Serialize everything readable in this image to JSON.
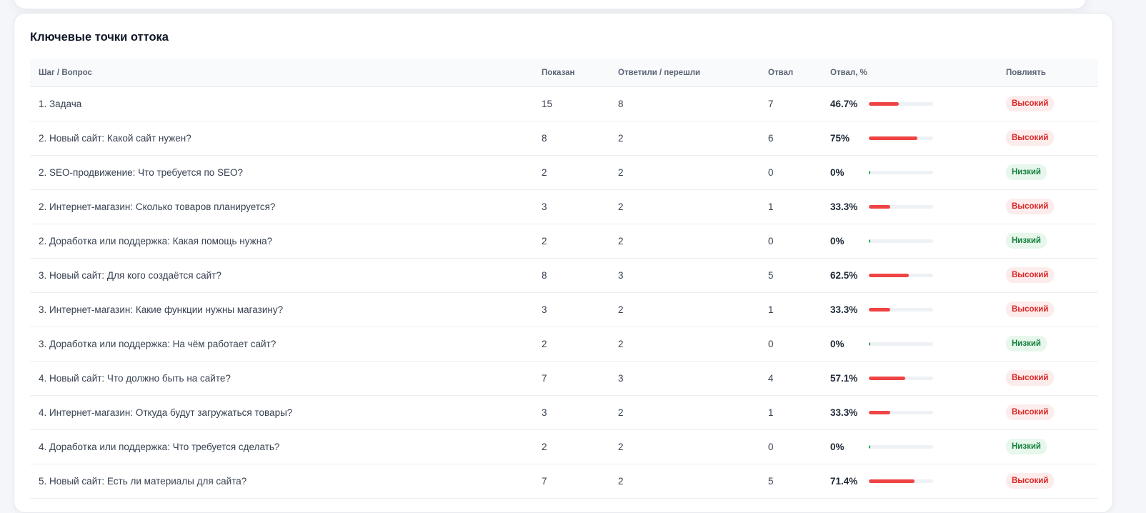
{
  "title": "Ключевые точки оттока",
  "columns": [
    "Шаг / Вопрос",
    "Показан",
    "Ответили / перешли",
    "Отвал",
    "Отвал, %",
    "Повлиять"
  ],
  "colors": {
    "high_badge_bg": "#fdecec",
    "high_badge_text": "#dc2626",
    "low_badge_bg": "#e7f7ec",
    "low_badge_text": "#15803d",
    "bar_fill": "#ef4444"
  },
  "rows": [
    {
      "step": "1. Задача",
      "shown": "15",
      "answered": "8",
      "dropped": "7",
      "drop_pct": "46.7%",
      "drop_fraction": 0.467,
      "impact": "Высокий",
      "impact_level": "high"
    },
    {
      "step": "2. Новый сайт: Какой сайт нужен?",
      "shown": "8",
      "answered": "2",
      "dropped": "6",
      "drop_pct": "75%",
      "drop_fraction": 0.75,
      "impact": "Высокий",
      "impact_level": "high"
    },
    {
      "step": "2. SEO-продвижение: Что требуется по SEO?",
      "shown": "2",
      "answered": "2",
      "dropped": "0",
      "drop_pct": "0%",
      "drop_fraction": 0,
      "impact": "Низкий",
      "impact_level": "low"
    },
    {
      "step": "2. Интернет-магазин: Сколько товаров планируется?",
      "shown": "3",
      "answered": "2",
      "dropped": "1",
      "drop_pct": "33.3%",
      "drop_fraction": 0.333,
      "impact": "Высокий",
      "impact_level": "high"
    },
    {
      "step": "2. Доработка или поддержка: Какая помощь нужна?",
      "shown": "2",
      "answered": "2",
      "dropped": "0",
      "drop_pct": "0%",
      "drop_fraction": 0,
      "impact": "Низкий",
      "impact_level": "low"
    },
    {
      "step": "3. Новый сайт: Для кого создаётся сайт?",
      "shown": "8",
      "answered": "3",
      "dropped": "5",
      "drop_pct": "62.5%",
      "drop_fraction": 0.625,
      "impact": "Высокий",
      "impact_level": "high"
    },
    {
      "step": "3. Интернет-магазин: Какие функции нужны магазину?",
      "shown": "3",
      "answered": "2",
      "dropped": "1",
      "drop_pct": "33.3%",
      "drop_fraction": 0.333,
      "impact": "Высокий",
      "impact_level": "high"
    },
    {
      "step": "3. Доработка или поддержка: На чём работает сайт?",
      "shown": "2",
      "answered": "2",
      "dropped": "0",
      "drop_pct": "0%",
      "drop_fraction": 0,
      "impact": "Низкий",
      "impact_level": "low"
    },
    {
      "step": "4. Новый сайт: Что должно быть на сайте?",
      "shown": "7",
      "answered": "3",
      "dropped": "4",
      "drop_pct": "57.1%",
      "drop_fraction": 0.571,
      "impact": "Высокий",
      "impact_level": "high"
    },
    {
      "step": "4. Интернет-магазин: Откуда будут загружаться товары?",
      "shown": "3",
      "answered": "2",
      "dropped": "1",
      "drop_pct": "33.3%",
      "drop_fraction": 0.333,
      "impact": "Высокий",
      "impact_level": "high"
    },
    {
      "step": "4. Доработка или поддержка: Что требуется сделать?",
      "shown": "2",
      "answered": "2",
      "dropped": "0",
      "drop_pct": "0%",
      "drop_fraction": 0,
      "impact": "Низкий",
      "impact_level": "low"
    },
    {
      "step": "5. Новый сайт: Есть ли материалы для сайта?",
      "shown": "7",
      "answered": "2",
      "dropped": "5",
      "drop_pct": "71.4%",
      "drop_fraction": 0.714,
      "impact": "Высокий",
      "impact_level": "high"
    }
  ]
}
